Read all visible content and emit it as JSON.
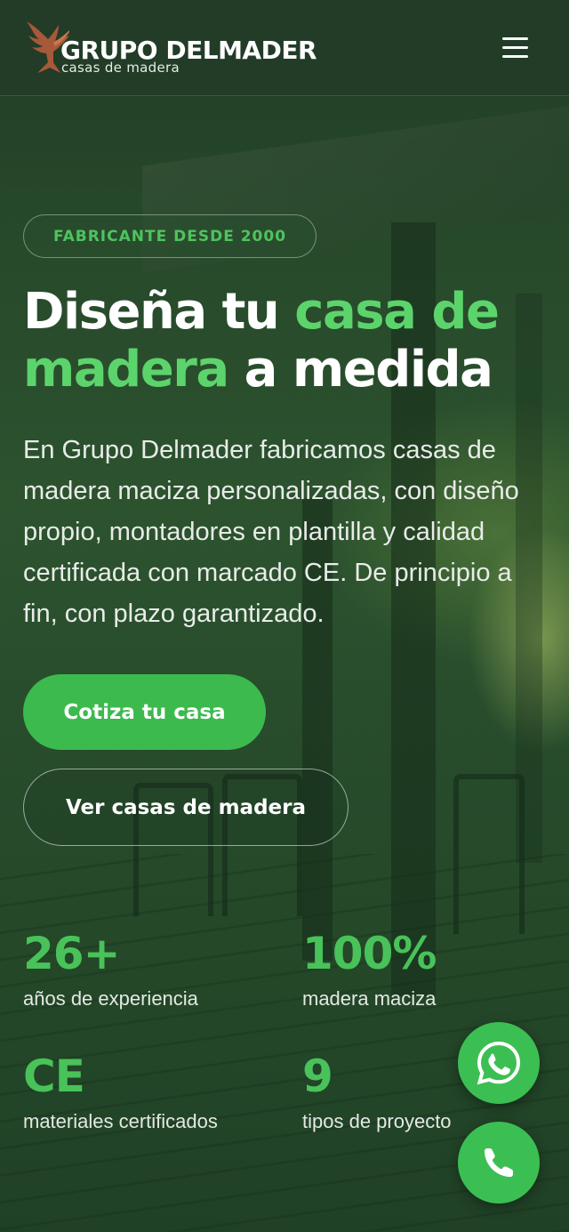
{
  "header": {
    "brand_name": "GRUPO DELMADER",
    "tagline": "casas de madera"
  },
  "hero": {
    "badge": "FABRICANTE DESDE 2000",
    "title_part1": "Diseña tu ",
    "title_accent1": "casa de madera",
    "title_part2": " a medida",
    "description": "En Grupo Delmader fabricamos casas de madera maciza personalizadas, con diseño propio, montadores en plantilla y calidad certificada con marcado CE. De principio a fin, con plazo garantizado.",
    "primary_cta": "Cotiza tu casa",
    "secondary_cta": "Ver casas de madera"
  },
  "stats": [
    {
      "value": "26+",
      "label": "años de experiencia"
    },
    {
      "value": "100%",
      "label": "madera maciza"
    },
    {
      "value": "CE",
      "label": "materiales certificados"
    },
    {
      "value": "9",
      "label": "tipos de proyecto"
    }
  ],
  "colors": {
    "accent": "#5cd46c",
    "button_green": "#3cba4e",
    "header_bg": "#223c28"
  },
  "icons": {
    "menu": "hamburger-menu-icon",
    "logo": "eagle-logo-icon",
    "whatsapp": "whatsapp-icon",
    "phone": "phone-icon"
  }
}
